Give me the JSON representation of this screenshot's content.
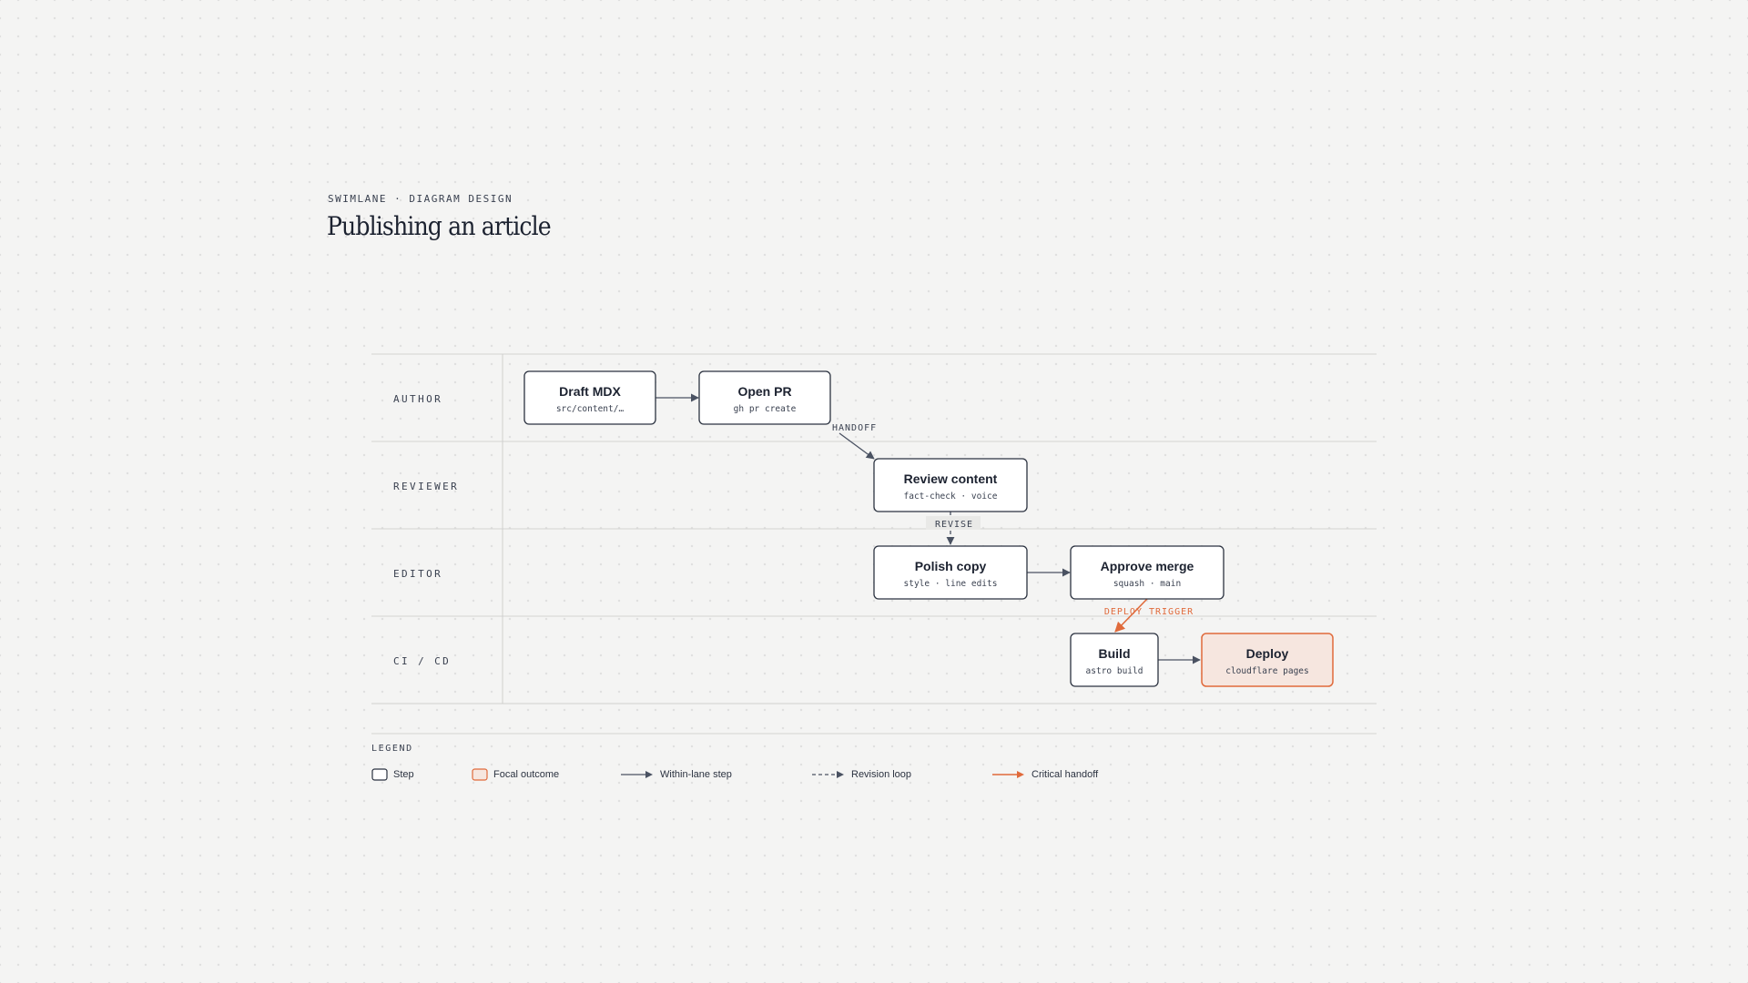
{
  "header": {
    "eyebrow": "SWIMLANE · DIAGRAM DESIGN",
    "title": "Publishing an article"
  },
  "lanes": [
    {
      "id": "author",
      "label": "AUTHOR"
    },
    {
      "id": "reviewer",
      "label": "REVIEWER"
    },
    {
      "id": "editor",
      "label": "EDITOR"
    },
    {
      "id": "cicd",
      "label": "CI / CD"
    }
  ],
  "nodes": [
    {
      "id": "draft-mdx",
      "title": "Draft MDX",
      "subtitle": "src/content/…"
    },
    {
      "id": "open-pr",
      "title": "Open PR",
      "subtitle": "gh pr create"
    },
    {
      "id": "review-content",
      "title": "Review content",
      "subtitle": "fact-check · voice"
    },
    {
      "id": "polish-copy",
      "title": "Polish copy",
      "subtitle": "style · line edits"
    },
    {
      "id": "approve-merge",
      "title": "Approve merge",
      "subtitle": "squash · main"
    },
    {
      "id": "build",
      "title": "Build",
      "subtitle": "astro build"
    },
    {
      "id": "deploy",
      "title": "Deploy",
      "subtitle": "cloudflare pages",
      "focal": true
    }
  ],
  "edges": [
    {
      "from": "draft-mdx",
      "to": "open-pr",
      "kind": "within-lane",
      "label": ""
    },
    {
      "from": "open-pr",
      "to": "review-content",
      "kind": "handoff",
      "label": "HANDOFF"
    },
    {
      "from": "review-content",
      "to": "polish-copy",
      "kind": "revision",
      "label": "REVISE"
    },
    {
      "from": "polish-copy",
      "to": "approve-merge",
      "kind": "within-lane",
      "label": ""
    },
    {
      "from": "approve-merge",
      "to": "build",
      "kind": "critical",
      "label": "DEPLOY TRIGGER"
    },
    {
      "from": "build",
      "to": "deploy",
      "kind": "within-lane",
      "label": ""
    }
  ],
  "legend": {
    "title": "LEGEND",
    "items": [
      {
        "key": "step",
        "label": "Step"
      },
      {
        "key": "focal",
        "label": "Focal outcome"
      },
      {
        "key": "within",
        "label": "Within-lane step"
      },
      {
        "key": "revision",
        "label": "Revision loop"
      },
      {
        "key": "critical",
        "label": "Critical handoff"
      }
    ]
  },
  "colors": {
    "ink": "#1f2533",
    "line": "#4a5262",
    "accent": "#e06a3b",
    "focal_fill": "#f6e6df",
    "grid": "#d8d8d6"
  }
}
